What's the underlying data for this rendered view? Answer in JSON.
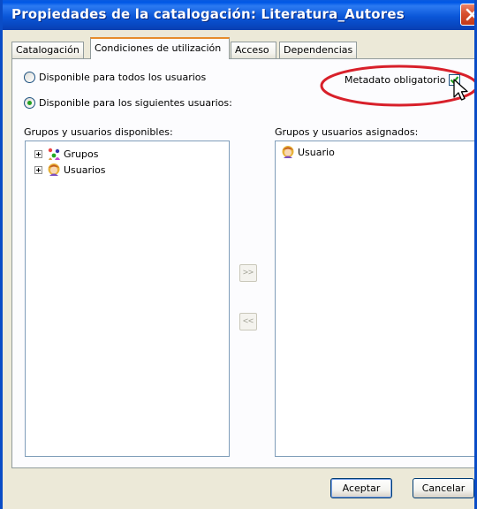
{
  "window": {
    "title": "Propiedades de la catalogación:  Literatura_Autores"
  },
  "tabs": [
    {
      "label": "Catalogación",
      "active": false
    },
    {
      "label": "Condiciones de utilización",
      "active": true
    },
    {
      "label": "Acceso",
      "active": false
    },
    {
      "label": "Dependencias",
      "active": false
    }
  ],
  "availability": {
    "option_all": "Disponible para todos los usuarios",
    "option_some": "Disponible para los siguientes usuarios:",
    "selected": "option_some"
  },
  "mandatory": {
    "label": "Metadato obligatorio",
    "checked": true
  },
  "available": {
    "header": "Grupos y usuarios disponibles:",
    "items": [
      {
        "label": "Grupos",
        "icon": "groups-icon"
      },
      {
        "label": "Usuarios",
        "icon": "users-icon"
      }
    ]
  },
  "assigned": {
    "header": "Grupos y usuarios asignados:",
    "items": [
      {
        "label": "Usuario",
        "icon": "user-icon"
      }
    ]
  },
  "move_buttons": {
    "add": ">>",
    "remove": "<<"
  },
  "buttons": {
    "ok": "Aceptar",
    "cancel": "Cancelar"
  },
  "colors": {
    "titlebar": "#0a56d8",
    "highlight_ellipse": "#d8202a",
    "tab_accent": "#e68b2c"
  }
}
